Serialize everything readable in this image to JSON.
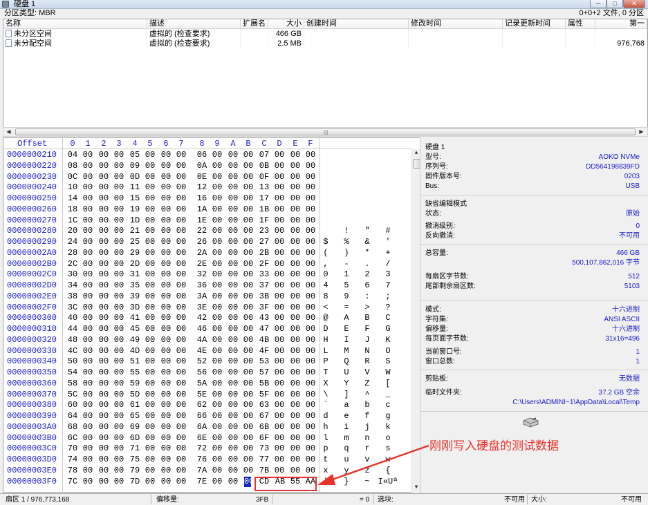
{
  "window": {
    "title": "硬盘 1",
    "min_label": "─",
    "max_label": "□",
    "close_label": "✕"
  },
  "partition": {
    "type_label": "分区类型: MBR",
    "file_count": "0+0+2 文件, 0 分区"
  },
  "table": {
    "headers": [
      "名称",
      "描述",
      "扩展名",
      "大小",
      "创建时间",
      "修改时间",
      "记录更新时间",
      "属性",
      "第一"
    ],
    "rows": [
      {
        "name": "未分区空间",
        "desc": "虚拟的 (检查要求)",
        "ext": "",
        "size": "466 GB",
        "created": "",
        "modified": "",
        "updated": "",
        "attr": "",
        "first": ""
      },
      {
        "name": "未分配空间",
        "desc": "虚拟的 (检查要求)",
        "ext": "",
        "size": "2.5 MB",
        "created": "",
        "modified": "",
        "updated": "",
        "attr": "",
        "first": "976,768"
      }
    ]
  },
  "hex": {
    "offset_label": "Offset",
    "columns": [
      "0",
      "1",
      "2",
      "3",
      "4",
      "5",
      "6",
      "7",
      "8",
      "9",
      "A",
      "B",
      "C",
      "D",
      "E",
      "F"
    ],
    "rows": [
      {
        "offset": "0000000210",
        "bytes": [
          "04",
          "00",
          "00",
          "00",
          "05",
          "00",
          "00",
          "00",
          "06",
          "00",
          "00",
          "00",
          "07",
          "00",
          "00",
          "00"
        ],
        "chars": [
          "",
          "",
          "",
          ""
        ]
      },
      {
        "offset": "0000000220",
        "bytes": [
          "08",
          "00",
          "00",
          "00",
          "09",
          "00",
          "00",
          "00",
          "0A",
          "00",
          "00",
          "00",
          "0B",
          "00",
          "00",
          "00"
        ],
        "chars": [
          "",
          "",
          "",
          ""
        ]
      },
      {
        "offset": "0000000230",
        "bytes": [
          "0C",
          "00",
          "00",
          "00",
          "0D",
          "00",
          "00",
          "00",
          "0E",
          "00",
          "00",
          "00",
          "0F",
          "00",
          "00",
          "00"
        ],
        "chars": [
          "",
          "",
          "",
          ""
        ]
      },
      {
        "offset": "0000000240",
        "bytes": [
          "10",
          "00",
          "00",
          "00",
          "11",
          "00",
          "00",
          "00",
          "12",
          "00",
          "00",
          "00",
          "13",
          "00",
          "00",
          "00"
        ],
        "chars": [
          "",
          "",
          "",
          ""
        ]
      },
      {
        "offset": "0000000250",
        "bytes": [
          "14",
          "00",
          "00",
          "00",
          "15",
          "00",
          "00",
          "00",
          "16",
          "00",
          "00",
          "00",
          "17",
          "00",
          "00",
          "00"
        ],
        "chars": [
          "",
          "",
          "",
          ""
        ]
      },
      {
        "offset": "0000000260",
        "bytes": [
          "18",
          "00",
          "00",
          "00",
          "19",
          "00",
          "00",
          "00",
          "1A",
          "00",
          "00",
          "00",
          "1B",
          "00",
          "00",
          "00"
        ],
        "chars": [
          "",
          "",
          "",
          ""
        ]
      },
      {
        "offset": "0000000270",
        "bytes": [
          "1C",
          "00",
          "00",
          "00",
          "1D",
          "00",
          "00",
          "00",
          "1E",
          "00",
          "00",
          "00",
          "1F",
          "00",
          "00",
          "00"
        ],
        "chars": [
          "",
          "",
          "",
          ""
        ]
      },
      {
        "offset": "0000000280",
        "bytes": [
          "20",
          "00",
          "00",
          "00",
          "21",
          "00",
          "00",
          "00",
          "22",
          "00",
          "00",
          "00",
          "23",
          "00",
          "00",
          "00"
        ],
        "chars": [
          "",
          "!",
          "\"",
          "#"
        ]
      },
      {
        "offset": "0000000290",
        "bytes": [
          "24",
          "00",
          "00",
          "00",
          "25",
          "00",
          "00",
          "00",
          "26",
          "00",
          "00",
          "00",
          "27",
          "00",
          "00",
          "00"
        ],
        "chars": [
          "$",
          "%",
          "&",
          "'"
        ]
      },
      {
        "offset": "00000002A0",
        "bytes": [
          "28",
          "00",
          "00",
          "00",
          "29",
          "00",
          "00",
          "00",
          "2A",
          "00",
          "00",
          "00",
          "2B",
          "00",
          "00",
          "00"
        ],
        "chars": [
          "(",
          ")",
          "*",
          "+"
        ]
      },
      {
        "offset": "00000002B0",
        "bytes": [
          "2C",
          "00",
          "00",
          "00",
          "2D",
          "00",
          "00",
          "00",
          "2E",
          "00",
          "00",
          "00",
          "2F",
          "00",
          "00",
          "00"
        ],
        "chars": [
          ",",
          "-",
          ".",
          "/"
        ]
      },
      {
        "offset": "00000002C0",
        "bytes": [
          "30",
          "00",
          "00",
          "00",
          "31",
          "00",
          "00",
          "00",
          "32",
          "00",
          "00",
          "00",
          "33",
          "00",
          "00",
          "00"
        ],
        "chars": [
          "0",
          "1",
          "2",
          "3"
        ]
      },
      {
        "offset": "00000002D0",
        "bytes": [
          "34",
          "00",
          "00",
          "00",
          "35",
          "00",
          "00",
          "00",
          "36",
          "00",
          "00",
          "00",
          "37",
          "00",
          "00",
          "00"
        ],
        "chars": [
          "4",
          "5",
          "6",
          "7"
        ]
      },
      {
        "offset": "00000002E0",
        "bytes": [
          "38",
          "00",
          "00",
          "00",
          "39",
          "00",
          "00",
          "00",
          "3A",
          "00",
          "00",
          "00",
          "3B",
          "00",
          "00",
          "00"
        ],
        "chars": [
          "8",
          "9",
          ":",
          ";"
        ]
      },
      {
        "offset": "00000002F0",
        "bytes": [
          "3C",
          "00",
          "00",
          "00",
          "3D",
          "00",
          "00",
          "00",
          "3E",
          "00",
          "00",
          "00",
          "3F",
          "00",
          "00",
          "00"
        ],
        "chars": [
          "<",
          "=",
          ">",
          "?"
        ]
      },
      {
        "offset": "0000000300",
        "bytes": [
          "40",
          "00",
          "00",
          "00",
          "41",
          "00",
          "00",
          "00",
          "42",
          "00",
          "00",
          "00",
          "43",
          "00",
          "00",
          "00"
        ],
        "chars": [
          "@",
          "A",
          "B",
          "C"
        ]
      },
      {
        "offset": "0000000310",
        "bytes": [
          "44",
          "00",
          "00",
          "00",
          "45",
          "00",
          "00",
          "00",
          "46",
          "00",
          "00",
          "00",
          "47",
          "00",
          "00",
          "00"
        ],
        "chars": [
          "D",
          "E",
          "F",
          "G"
        ]
      },
      {
        "offset": "0000000320",
        "bytes": [
          "48",
          "00",
          "00",
          "00",
          "49",
          "00",
          "00",
          "00",
          "4A",
          "00",
          "00",
          "00",
          "4B",
          "00",
          "00",
          "00"
        ],
        "chars": [
          "H",
          "I",
          "J",
          "K"
        ]
      },
      {
        "offset": "0000000330",
        "bytes": [
          "4C",
          "00",
          "00",
          "00",
          "4D",
          "00",
          "00",
          "00",
          "4E",
          "00",
          "00",
          "00",
          "4F",
          "00",
          "00",
          "00"
        ],
        "chars": [
          "L",
          "M",
          "N",
          "O"
        ]
      },
      {
        "offset": "0000000340",
        "bytes": [
          "50",
          "00",
          "00",
          "00",
          "51",
          "00",
          "00",
          "00",
          "52",
          "00",
          "00",
          "00",
          "53",
          "00",
          "00",
          "00"
        ],
        "chars": [
          "P",
          "Q",
          "R",
          "S"
        ]
      },
      {
        "offset": "0000000350",
        "bytes": [
          "54",
          "00",
          "00",
          "00",
          "55",
          "00",
          "00",
          "00",
          "56",
          "00",
          "00",
          "00",
          "57",
          "00",
          "00",
          "00"
        ],
        "chars": [
          "T",
          "U",
          "V",
          "W"
        ]
      },
      {
        "offset": "0000000360",
        "bytes": [
          "58",
          "00",
          "00",
          "00",
          "59",
          "00",
          "00",
          "00",
          "5A",
          "00",
          "00",
          "00",
          "5B",
          "00",
          "00",
          "00"
        ],
        "chars": [
          "X",
          "Y",
          "Z",
          "["
        ]
      },
      {
        "offset": "0000000370",
        "bytes": [
          "5C",
          "00",
          "00",
          "00",
          "5D",
          "00",
          "00",
          "00",
          "5E",
          "00",
          "00",
          "00",
          "5F",
          "00",
          "00",
          "00"
        ],
        "chars": [
          "\\",
          "]",
          "^",
          "_"
        ]
      },
      {
        "offset": "0000000380",
        "bytes": [
          "60",
          "00",
          "00",
          "00",
          "61",
          "00",
          "00",
          "00",
          "62",
          "00",
          "00",
          "00",
          "63",
          "00",
          "00",
          "00"
        ],
        "chars": [
          "`",
          "a",
          "b",
          "c"
        ]
      },
      {
        "offset": "0000000390",
        "bytes": [
          "64",
          "00",
          "00",
          "00",
          "65",
          "00",
          "00",
          "00",
          "66",
          "00",
          "00",
          "00",
          "67",
          "00",
          "00",
          "00"
        ],
        "chars": [
          "d",
          "e",
          "f",
          "g"
        ]
      },
      {
        "offset": "00000003A0",
        "bytes": [
          "68",
          "00",
          "00",
          "00",
          "69",
          "00",
          "00",
          "00",
          "6A",
          "00",
          "00",
          "00",
          "6B",
          "00",
          "00",
          "00"
        ],
        "chars": [
          "h",
          "i",
          "j",
          "k"
        ]
      },
      {
        "offset": "00000003B0",
        "bytes": [
          "6C",
          "00",
          "00",
          "00",
          "6D",
          "00",
          "00",
          "00",
          "6E",
          "00",
          "00",
          "00",
          "6F",
          "00",
          "00",
          "00"
        ],
        "chars": [
          "l",
          "m",
          "n",
          "o"
        ]
      },
      {
        "offset": "00000003C0",
        "bytes": [
          "70",
          "00",
          "00",
          "00",
          "71",
          "00",
          "00",
          "00",
          "72",
          "00",
          "00",
          "00",
          "73",
          "00",
          "00",
          "00"
        ],
        "chars": [
          "p",
          "q",
          "r",
          "s"
        ]
      },
      {
        "offset": "00000003D0",
        "bytes": [
          "74",
          "00",
          "00",
          "00",
          "75",
          "00",
          "00",
          "00",
          "76",
          "00",
          "00",
          "00",
          "77",
          "00",
          "00",
          "00"
        ],
        "chars": [
          "t",
          "u",
          "v",
          "w"
        ]
      },
      {
        "offset": "00000003E0",
        "bytes": [
          "78",
          "00",
          "00",
          "00",
          "79",
          "00",
          "00",
          "00",
          "7A",
          "00",
          "00",
          "00",
          "7B",
          "00",
          "00",
          "00"
        ],
        "chars": [
          "x",
          "y",
          "z",
          "{"
        ]
      },
      {
        "offset": "00000003F0",
        "bytes": [
          "7C",
          "00",
          "00",
          "00",
          "7D",
          "00",
          "00",
          "00",
          "7E",
          "00",
          "00",
          "00",
          "CD",
          "AB",
          "55",
          "AA"
        ],
        "chars": [
          "|",
          "}",
          "~",
          "I«Uª"
        ]
      }
    ],
    "selected_byte": "00"
  },
  "info": {
    "disk_title": "硬盘 1",
    "model_label": "型号:",
    "model": "AOKO NVMe",
    "serial_label": "序列号:",
    "serial": "DD564198839FD",
    "firmware_label": "固件版本号:",
    "firmware": "0203",
    "bus_label": "Bus:",
    "bus": "USB",
    "edit_mode_label": "缺省编辑模式",
    "state_label": "状态:",
    "state": "原始",
    "undo_level_label": "撤消级别:",
    "undo_level": "0",
    "redo_label": "反向撤消:",
    "redo": "不可用",
    "capacity_label": "总容量:",
    "capacity": "466 GB",
    "capacity_bytes": "500,107,862,016 字节",
    "bps_label": "每扇区字节数:",
    "bps": "512",
    "tail_label": "尾部剩余扇区数:",
    "tail": "5103",
    "mode_label": "模式:",
    "mode": "十六进制",
    "charset_label": "字符集:",
    "charset": "ANSI ASCII",
    "offset_label": "偏移量:",
    "offset": "十六进制",
    "bpp_label": "每页面字节数:",
    "bpp": "31x16=496",
    "cur_window_label": "当前窗口号:",
    "cur_window": "1",
    "total_window_label": "窗口总数:",
    "total_window": "1",
    "clipboard_label": "剪贴板:",
    "clipboard": "无数据",
    "temp_label": "临时文件夹:",
    "temp_free": "37.2 GB 空余",
    "temp_path": "C:\\Users\\ADMINI~1\\AppData\\Local\\Temp"
  },
  "annotation": {
    "text": "刚刚写入硬盘的测试数据",
    "color": "#e8332b"
  },
  "status": {
    "sector": "扇区 1 / 976,773,168",
    "offset_label": "偏移量:",
    "offset_value": "3FB",
    "eq": "= 0",
    "sel_label": "选块:",
    "sel_value": "不可用",
    "size_label": "大小:",
    "size_value": "不可用"
  }
}
